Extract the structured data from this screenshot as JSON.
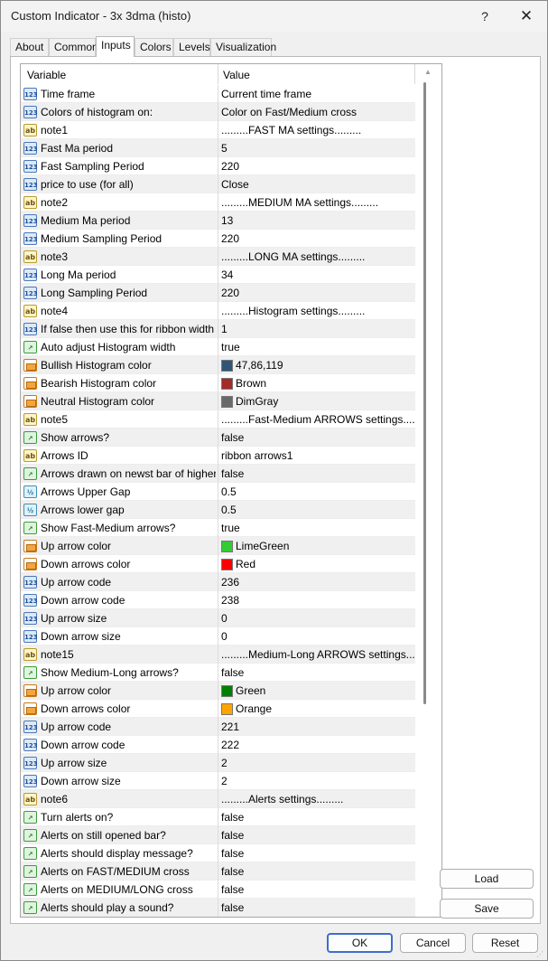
{
  "window": {
    "title": "Custom Indicator - 3x 3dma (histo)",
    "help_label": "?",
    "close_label": "✕"
  },
  "tabs": [
    {
      "label": "About"
    },
    {
      "label": "Common"
    },
    {
      "label": "Inputs"
    },
    {
      "label": "Colors"
    },
    {
      "label": "Levels"
    },
    {
      "label": "Visualization"
    }
  ],
  "active_tab": "Inputs",
  "grid": {
    "header_variable": "Variable",
    "header_value": "Value",
    "rows": [
      {
        "type": "int",
        "name": "Time frame",
        "value": "Current time frame"
      },
      {
        "type": "int",
        "name": "Colors of histogram on:",
        "value": "Color on Fast/Medium cross"
      },
      {
        "type": "string",
        "name": "note1",
        "value": ".........FAST MA settings........."
      },
      {
        "type": "int",
        "name": "Fast Ma period",
        "value": "5"
      },
      {
        "type": "int",
        "name": "Fast Sampling Period",
        "value": "220"
      },
      {
        "type": "int",
        "name": "price to use (for all)",
        "value": "Close"
      },
      {
        "type": "string",
        "name": "note2",
        "value": ".........MEDIUM MA settings........."
      },
      {
        "type": "int",
        "name": "Medium Ma period",
        "value": "13"
      },
      {
        "type": "int",
        "name": "Medium Sampling Period",
        "value": "220"
      },
      {
        "type": "string",
        "name": "note3",
        "value": ".........LONG MA settings........."
      },
      {
        "type": "int",
        "name": "Long Ma period",
        "value": "34"
      },
      {
        "type": "int",
        "name": "Long Sampling Period",
        "value": "220"
      },
      {
        "type": "string",
        "name": "note4",
        "value": ".........Histogram  settings........."
      },
      {
        "type": "int",
        "name": "If  false then use this for ribbon width",
        "value": "1"
      },
      {
        "type": "bool",
        "name": "Auto adjust Histogram width",
        "value": "true"
      },
      {
        "type": "color",
        "name": "Bullish Histogram  color",
        "value": "47,86,119",
        "swatch": "#2f5677"
      },
      {
        "type": "color",
        "name": "Bearish Histogram  color",
        "value": "Brown",
        "swatch": "#a52a2a"
      },
      {
        "type": "color",
        "name": "Neutral Histogram  color",
        "value": "DimGray",
        "swatch": "#696969"
      },
      {
        "type": "string",
        "name": "note5",
        "value": ".........Fast-Medium ARROWS settings........."
      },
      {
        "type": "bool",
        "name": "Show arrows?",
        "value": "false"
      },
      {
        "type": "string",
        "name": "Arrows ID",
        "value": "ribbon arrows1"
      },
      {
        "type": "bool",
        "name": "Arrows drawn on newst bar of higher time frame bar?",
        "value": "false"
      },
      {
        "type": "double",
        "name": "Arrows Upper Gap",
        "value": "0.5"
      },
      {
        "type": "double",
        "name": "Arrows lower gap",
        "value": "0.5"
      },
      {
        "type": "bool",
        "name": "Show Fast-Medium arrows?",
        "value": "true"
      },
      {
        "type": "color",
        "name": "Up arrow color",
        "value": "LimeGreen",
        "swatch": "#32cd32"
      },
      {
        "type": "color",
        "name": "Down arrows color",
        "value": "Red",
        "swatch": "#ff0000"
      },
      {
        "type": "int",
        "name": "Up arrow code",
        "value": "236"
      },
      {
        "type": "int",
        "name": "Down arrow code",
        "value": "238"
      },
      {
        "type": "int",
        "name": "Up arrow size",
        "value": "0"
      },
      {
        "type": "int",
        "name": "Down arrow size",
        "value": "0"
      },
      {
        "type": "string",
        "name": "note15",
        "value": ".........Medium-Long ARROWS settings........."
      },
      {
        "type": "bool",
        "name": "Show Medium-Long arrows?",
        "value": "false"
      },
      {
        "type": "color",
        "name": "Up arrow color",
        "value": "Green",
        "swatch": "#008000"
      },
      {
        "type": "color",
        "name": "Down arrows color",
        "value": "Orange",
        "swatch": "#ffa500"
      },
      {
        "type": "int",
        "name": "Up arrow code",
        "value": "221"
      },
      {
        "type": "int",
        "name": "Down arrow code",
        "value": "222"
      },
      {
        "type": "int",
        "name": "Up arrow size",
        "value": "2"
      },
      {
        "type": "int",
        "name": "Down arrow size",
        "value": "2"
      },
      {
        "type": "string",
        "name": "note6",
        "value": ".........Alerts settings........."
      },
      {
        "type": "bool",
        "name": "Turn alerts on?",
        "value": "false"
      },
      {
        "type": "bool",
        "name": "Alerts on still opened bar?",
        "value": "false"
      },
      {
        "type": "bool",
        "name": "Alerts should display message?",
        "value": "false"
      },
      {
        "type": "bool",
        "name": "Alerts on  FAST/MEDIUM cross",
        "value": "false"
      },
      {
        "type": "bool",
        "name": "Alerts on MEDIUM/LONG cross",
        "value": "false"
      },
      {
        "type": "bool",
        "name": "Alerts should play a sound?",
        "value": "false"
      }
    ]
  },
  "side_buttons": {
    "load_label": "Load",
    "save_label": "Save"
  },
  "footer": {
    "ok_label": "OK",
    "cancel_label": "Cancel",
    "reset_label": "Reset"
  },
  "icon_text": {
    "int": "123",
    "double": "½",
    "string": "ab",
    "bool": "↗"
  }
}
